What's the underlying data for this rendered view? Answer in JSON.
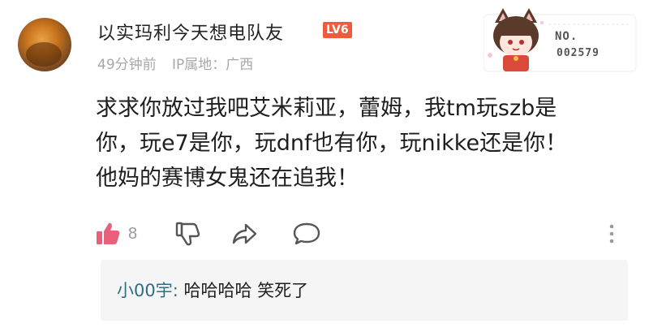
{
  "comment": {
    "username": "以实玛利今天想电队友",
    "level_badge": "LV6",
    "time_ago": "49分钟前",
    "ip_location": "IP属地：广西",
    "decoration": {
      "no_label": "NO.",
      "number": "002579"
    },
    "body_lines": [
      "求求你放过我吧艾米莉亚，蕾姆，我tm玩szb是",
      "你，玩e7是你，玩dnf也有你，玩nikke还是你！",
      "他妈的赛博女鬼还在追我！"
    ],
    "actions": {
      "like_count": "8",
      "like_color": "#e8607a",
      "icon_color": "#555555"
    }
  },
  "reply": {
    "author": "小00宇:",
    "text": " 哈哈哈哈 笑死了"
  }
}
